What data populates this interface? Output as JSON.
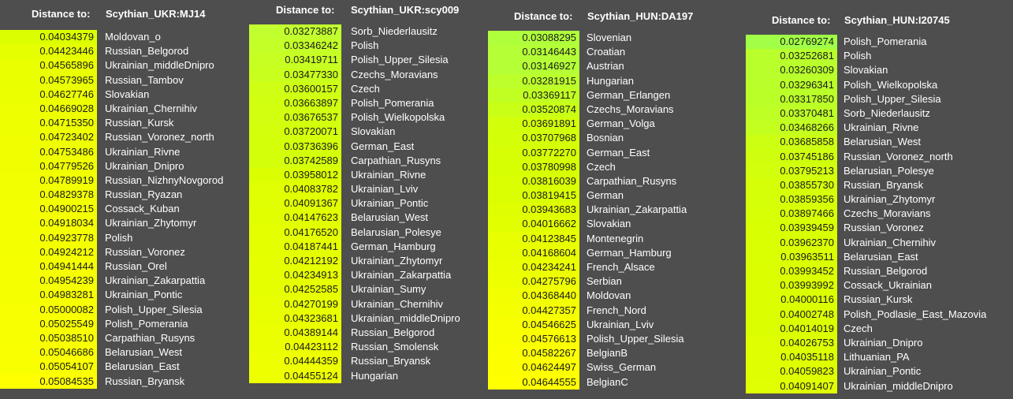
{
  "tables": [
    {
      "header_label": "Distance to:",
      "target": "Scythian_UKR:MJ14",
      "rows": [
        {
          "value": "0.04034379",
          "population": "Moldovan_o",
          "fill": "#dcff00"
        },
        {
          "value": "0.04423446",
          "population": "Russian_Belgorod",
          "fill": "#e6ff00"
        },
        {
          "value": "0.04565896",
          "population": "Ukrainian_middleDnipro",
          "fill": "#eaff00"
        },
        {
          "value": "0.04573965",
          "population": "Russian_Tambov",
          "fill": "#eaff00"
        },
        {
          "value": "0.04627746",
          "population": "Slovakian",
          "fill": "#ecff00"
        },
        {
          "value": "0.04669028",
          "population": "Ukrainian_Chernihiv",
          "fill": "#edff00"
        },
        {
          "value": "0.04715350",
          "population": "Russian_Kursk",
          "fill": "#eeff00"
        },
        {
          "value": "0.04723402",
          "population": "Russian_Voronez_north",
          "fill": "#efff00"
        },
        {
          "value": "0.04753486",
          "population": "Ukrainian_Rivne",
          "fill": "#f0ff00"
        },
        {
          "value": "0.04779526",
          "population": "Ukrainian_Dnipro",
          "fill": "#f0ff00"
        },
        {
          "value": "0.04789919",
          "population": "Russian_NizhnyNovgorod",
          "fill": "#f1ff00"
        },
        {
          "value": "0.04829378",
          "population": "Russian_Ryazan",
          "fill": "#f2ff00"
        },
        {
          "value": "0.04900215",
          "population": "Cossack_Kuban",
          "fill": "#f4ff00"
        },
        {
          "value": "0.04918034",
          "population": "Ukrainian_Zhytomyr",
          "fill": "#f4ff00"
        },
        {
          "value": "0.04923778",
          "population": "Polish",
          "fill": "#f4ff00"
        },
        {
          "value": "0.04924212",
          "population": "Russian_Voronez",
          "fill": "#f4ff00"
        },
        {
          "value": "0.04941444",
          "population": "Russian_Orel",
          "fill": "#f5ff00"
        },
        {
          "value": "0.04954239",
          "population": "Ukrainian_Zakarpattia",
          "fill": "#f5ff00"
        },
        {
          "value": "0.04983281",
          "population": "Ukrainian_Pontic",
          "fill": "#f6ff00"
        },
        {
          "value": "0.05000082",
          "population": "Polish_Upper_Silesia",
          "fill": "#f7ff00"
        },
        {
          "value": "0.05025549",
          "population": "Polish_Pomerania",
          "fill": "#f8ff00"
        },
        {
          "value": "0.05038510",
          "population": "Carpathian_Rusyns",
          "fill": "#f8ff00"
        },
        {
          "value": "0.05046686",
          "population": "Belarusian_West",
          "fill": "#f9ff00"
        },
        {
          "value": "0.05054107",
          "population": "Belarusian_East",
          "fill": "#faff00"
        },
        {
          "value": "0.05084535",
          "population": "Russian_Bryansk",
          "fill": "#ffff00"
        }
      ]
    },
    {
      "header_label": "Distance to:",
      "target": "Scythian_UKR:scy009",
      "rows": [
        {
          "value": "0.03273887",
          "population": "Sorb_Niederlausitz",
          "fill": "#c2ff2e"
        },
        {
          "value": "0.03346242",
          "population": "Polish",
          "fill": "#c4ff28"
        },
        {
          "value": "0.03419711",
          "population": "Polish_Upper_Silesia",
          "fill": "#c7ff22"
        },
        {
          "value": "0.03477330",
          "population": "Czechs_Moravians",
          "fill": "#c9ff1d"
        },
        {
          "value": "0.03600157",
          "population": "Czech",
          "fill": "#ceff14"
        },
        {
          "value": "0.03663897",
          "population": "Polish_Pomerania",
          "fill": "#d0ff10"
        },
        {
          "value": "0.03676537",
          "population": "Polish_Wielkopolska",
          "fill": "#d1ff0f"
        },
        {
          "value": "0.03720071",
          "population": "Slovakian",
          "fill": "#d3ff0c"
        },
        {
          "value": "0.03736396",
          "population": "German_East",
          "fill": "#d3ff0b"
        },
        {
          "value": "0.03742589",
          "population": "Carpathian_Rusyns",
          "fill": "#d4ff0a"
        },
        {
          "value": "0.03958012",
          "population": "Ukrainian_Rivne",
          "fill": "#dbff00"
        },
        {
          "value": "0.04083782",
          "population": "Ukrainian_Lviv",
          "fill": "#e0ff00"
        },
        {
          "value": "0.04091367",
          "population": "Ukrainian_Pontic",
          "fill": "#e0ff00"
        },
        {
          "value": "0.04147623",
          "population": "Belarusian_West",
          "fill": "#e2ff00"
        },
        {
          "value": "0.04176520",
          "population": "Belarusian_Polesye",
          "fill": "#e3ff00"
        },
        {
          "value": "0.04187441",
          "population": "German_Hamburg",
          "fill": "#e4ff00"
        },
        {
          "value": "0.04212192",
          "population": "Ukrainian_Zhytomyr",
          "fill": "#e5ff00"
        },
        {
          "value": "0.04234913",
          "population": "Ukrainian_Zakarpattia",
          "fill": "#e6ff00"
        },
        {
          "value": "0.04252585",
          "population": "Ukrainian_Sumy",
          "fill": "#e6ff00"
        },
        {
          "value": "0.04270199",
          "population": "Ukrainian_Chernihiv",
          "fill": "#e7ff00"
        },
        {
          "value": "0.04323681",
          "population": "Ukrainian_middleDnipro",
          "fill": "#e9ff00"
        },
        {
          "value": "0.04389144",
          "population": "Russian_Belgorod",
          "fill": "#ebff00"
        },
        {
          "value": "0.04423112",
          "population": "Russian_Smolensk",
          "fill": "#ecff00"
        },
        {
          "value": "0.04444359",
          "population": "Russian_Bryansk",
          "fill": "#edff00"
        },
        {
          "value": "0.04455124",
          "population": "Hungarian",
          "fill": "#eeff00"
        }
      ]
    },
    {
      "header_label": "Distance to:",
      "target": "Scythian_HUN:DA197",
      "rows": [
        {
          "value": "0.03088295",
          "population": "Slovenian",
          "fill": "#b0ff3c"
        },
        {
          "value": "0.03146443",
          "population": "Croatian",
          "fill": "#b4ff36"
        },
        {
          "value": "0.03146927",
          "population": "Austrian",
          "fill": "#b4ff36"
        },
        {
          "value": "0.03281915",
          "population": "Hungarian",
          "fill": "#bcff2a"
        },
        {
          "value": "0.03369117",
          "population": "German_Erlangen",
          "fill": "#c1ff22"
        },
        {
          "value": "0.03520874",
          "population": "Czechs_Moravians",
          "fill": "#c9ff16"
        },
        {
          "value": "0.03691891",
          "population": "German_Volga",
          "fill": "#d2ff0a"
        },
        {
          "value": "0.03707968",
          "population": "Bosnian",
          "fill": "#d3ff09"
        },
        {
          "value": "0.03772270",
          "population": "German_East",
          "fill": "#d6ff05"
        },
        {
          "value": "0.03780998",
          "population": "Czech",
          "fill": "#d7ff04"
        },
        {
          "value": "0.03816039",
          "population": "Carpathian_Rusyns",
          "fill": "#d9ff02"
        },
        {
          "value": "0.03819415",
          "population": "German",
          "fill": "#d9ff02"
        },
        {
          "value": "0.03943683",
          "population": "Ukrainian_Zakarpattia",
          "fill": "#dfff00"
        },
        {
          "value": "0.04016662",
          "population": "Slovakian",
          "fill": "#e2ff00"
        },
        {
          "value": "0.04123845",
          "population": "Montenegrin",
          "fill": "#e7ff00"
        },
        {
          "value": "0.04168604",
          "population": "German_Hamburg",
          "fill": "#e9ff00"
        },
        {
          "value": "0.04234241",
          "population": "French_Alsace",
          "fill": "#ecff00"
        },
        {
          "value": "0.04275796",
          "population": "Serbian",
          "fill": "#eeff00"
        },
        {
          "value": "0.04368440",
          "population": "Moldovan",
          "fill": "#f2ff00"
        },
        {
          "value": "0.04427357",
          "population": "French_Nord",
          "fill": "#f4ff00"
        },
        {
          "value": "0.04546625",
          "population": "Ukrainian_Lviv",
          "fill": "#f9ff00"
        },
        {
          "value": "0.04576613",
          "population": "Polish_Upper_Silesia",
          "fill": "#faff00"
        },
        {
          "value": "0.04582267",
          "population": "BelgianB",
          "fill": "#fbff00"
        },
        {
          "value": "0.04624497",
          "population": "Swiss_German",
          "fill": "#fdff00"
        },
        {
          "value": "0.04644555",
          "population": "BelgianC",
          "fill": "#ffff00"
        }
      ]
    },
    {
      "header_label": "Distance to:",
      "target": "Scythian_HUN:I20745",
      "rows": [
        {
          "value": "0.02769274",
          "population": "Polish_Pomerania",
          "fill": "#a0ff46"
        },
        {
          "value": "0.03252681",
          "population": "Polish",
          "fill": "#b8ff2c"
        },
        {
          "value": "0.03260309",
          "population": "Slovakian",
          "fill": "#b8ff2c"
        },
        {
          "value": "0.03296341",
          "population": "Polish_Wielkopolska",
          "fill": "#baff29"
        },
        {
          "value": "0.03317850",
          "population": "Polish_Upper_Silesia",
          "fill": "#bbff28"
        },
        {
          "value": "0.03370481",
          "population": "Sorb_Niederlausitz",
          "fill": "#beff25"
        },
        {
          "value": "0.03468266",
          "population": "Ukrainian_Rivne",
          "fill": "#c3ff1f"
        },
        {
          "value": "0.03685858",
          "population": "Belarusian_West",
          "fill": "#cdff12"
        },
        {
          "value": "0.03745186",
          "population": "Russian_Voronez_north",
          "fill": "#d0ff0e"
        },
        {
          "value": "0.03795213",
          "population": "Belarusian_Polesye",
          "fill": "#d2ff0b"
        },
        {
          "value": "0.03855730",
          "population": "Russian_Bryansk",
          "fill": "#d5ff08"
        },
        {
          "value": "0.03859356",
          "population": "Ukrainian_Zhytomyr",
          "fill": "#d5ff08"
        },
        {
          "value": "0.03897466",
          "population": "Czechs_Moravians",
          "fill": "#d7ff05"
        },
        {
          "value": "0.03939459",
          "population": "Russian_Voronez",
          "fill": "#d9ff03"
        },
        {
          "value": "0.03962370",
          "population": "Ukrainian_Chernihiv",
          "fill": "#daff02"
        },
        {
          "value": "0.03963511",
          "population": "Belarusian_East",
          "fill": "#daff02"
        },
        {
          "value": "0.03993452",
          "population": "Russian_Belgorod",
          "fill": "#dbff00"
        },
        {
          "value": "0.03993992",
          "population": "Cossack_Ukrainian",
          "fill": "#dbff00"
        },
        {
          "value": "0.04000116",
          "population": "Russian_Kursk",
          "fill": "#dcff00"
        },
        {
          "value": "0.04002748",
          "population": "Polish_Podlasie_East_Mazovia",
          "fill": "#dcff00"
        },
        {
          "value": "0.04014019",
          "population": "Czech",
          "fill": "#dcff00"
        },
        {
          "value": "0.04026753",
          "population": "Ukrainian_Dnipro",
          "fill": "#ddff00"
        },
        {
          "value": "0.04035118",
          "population": "Lithuanian_PA",
          "fill": "#ddff00"
        },
        {
          "value": "0.04059823",
          "population": "Ukrainian_Pontic",
          "fill": "#deff00"
        },
        {
          "value": "0.04091407",
          "population": "Ukrainian_middleDnipro",
          "fill": "#e0ff00"
        }
      ]
    }
  ]
}
